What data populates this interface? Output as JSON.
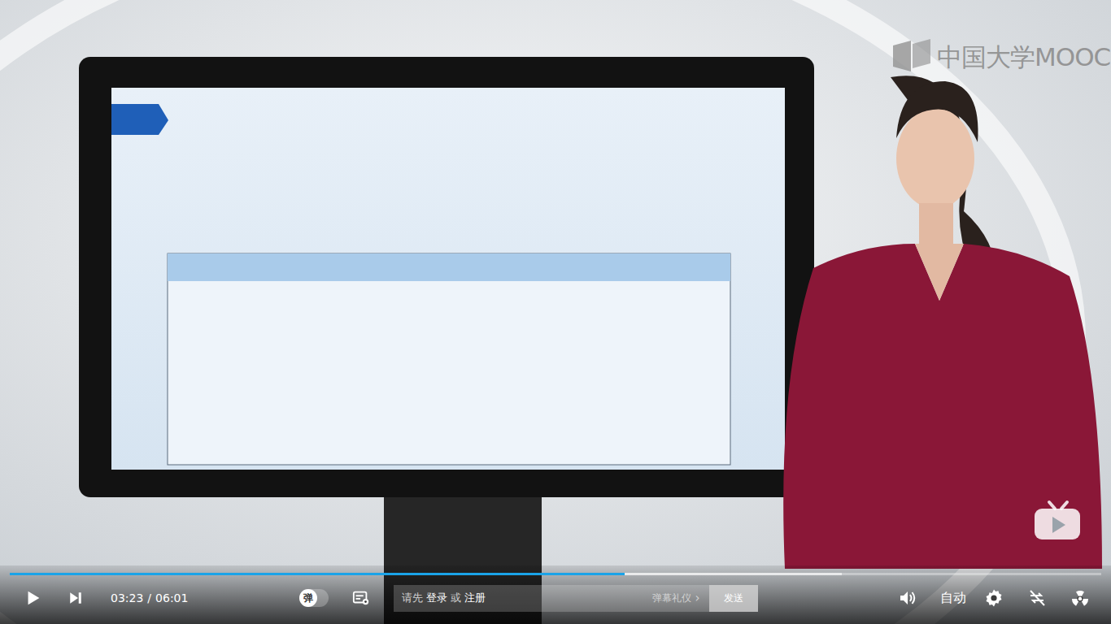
{
  "player": {
    "logo": "中国大学MOOC",
    "progress": {
      "played": 0.563,
      "buffered": 0.762
    },
    "current_time": "03:23",
    "separator": "/",
    "duration": "06:01",
    "danmaku_toggle": {
      "label": "弹",
      "on": false
    },
    "comment_box": {
      "prefix": "请先",
      "login": "登录",
      "or": "或",
      "register": "注册",
      "etiquette": "弹幕礼仪",
      "etiquette_arrow": "›",
      "send": "发送"
    },
    "quality": "自动"
  }
}
